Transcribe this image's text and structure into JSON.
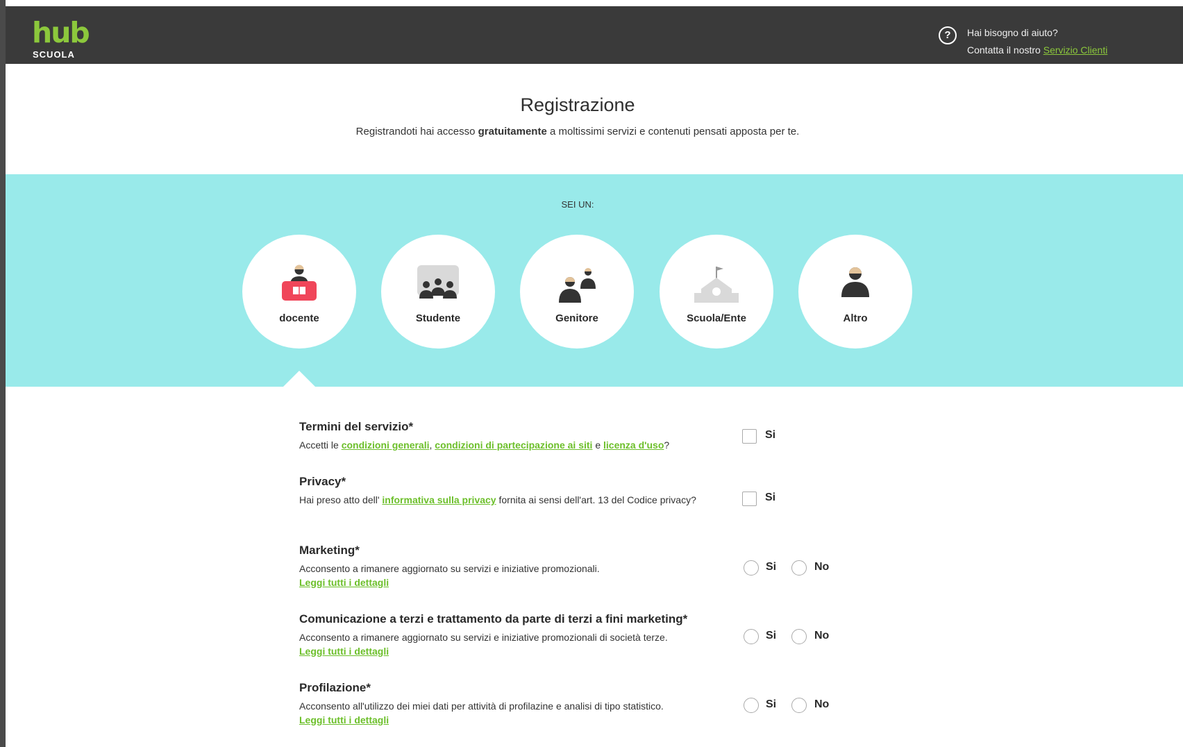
{
  "header": {
    "logo_main": "hub",
    "logo_sub": "SCUOLA",
    "help_question": "Hai bisogno di aiuto?",
    "help_contact_prefix": "Contatta il nostro ",
    "help_contact_link": "Servizio Clienti",
    "help_icon": "question-circle-icon"
  },
  "intro": {
    "title": "Registrazione",
    "subtitle_prefix": "Registrandoti hai accesso ",
    "subtitle_bold": "gratuitamente",
    "subtitle_suffix": " a moltissimi servizi e contenuti pensati apposta per te."
  },
  "roles": {
    "prompt": "SEI UN:",
    "selected": "docente",
    "items": [
      {
        "label": "docente",
        "icon": "teacher-icon"
      },
      {
        "label": "Studente",
        "icon": "students-icon"
      },
      {
        "label": "Genitore",
        "icon": "parents-icon"
      },
      {
        "label": "Scuola/Ente",
        "icon": "school-icon"
      },
      {
        "label": "Altro",
        "icon": "person-icon"
      }
    ]
  },
  "colors": {
    "header_bg": "#3a3a3a",
    "accent_green": "#8cc83c",
    "band_bg": "#99eaea",
    "teacher_red": "#f0465a"
  },
  "consents": {
    "terms": {
      "title": "Termini del servizio*",
      "desc_1": "Accetti le ",
      "link_1": "condizioni generali",
      "desc_2": ", ",
      "link_2": "condizioni di partecipazione ai siti",
      "desc_3": " e ",
      "link_3": "licenza d'uso",
      "desc_4": "?",
      "yes": "Si"
    },
    "privacy": {
      "title": "Privacy*",
      "desc_1": "Hai preso atto dell' ",
      "link_1": "informativa sulla privacy",
      "desc_2": " fornita ai sensi dell'art. 13 del Codice privacy?",
      "yes": "Si"
    },
    "marketing": {
      "title": "Marketing*",
      "desc": "Acconsento a rimanere aggiornato su servizi e iniziative promozionali.",
      "more": "Leggi tutti i dettagli",
      "yes": "Si",
      "no": "No"
    },
    "third_party": {
      "title": "Comunicazione a terzi e trattamento da parte di terzi a fini marketing*",
      "desc": "Acconsento a rimanere aggiornato su servizi e iniziative promozionali di società terze.",
      "more": "Leggi tutti i dettagli",
      "yes": "Si",
      "no": "No"
    },
    "profiling": {
      "title": "Profilazione*",
      "desc": "Acconsento all'utilizzo dei miei dati per attività di profilazine e analisi di tipo statistico.",
      "more": "Leggi tutti i dettagli",
      "yes": "Si",
      "no": "No"
    }
  }
}
